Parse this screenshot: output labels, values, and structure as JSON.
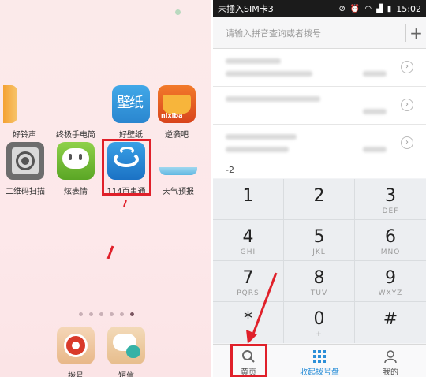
{
  "home": {
    "apps_row1": [
      {
        "label": "好铃声",
        "icon": "ringtone-icon"
      },
      {
        "label": "终极手电筒",
        "icon": "flashlight-icon"
      },
      {
        "label": "好壁纸",
        "icon": "wallpaper-icon"
      },
      {
        "label": "逆袭吧",
        "icon": "nixiba-icon"
      }
    ],
    "nixiba_text": "nixiba",
    "wallpaper_glyph": "壁纸",
    "apps_row2": [
      {
        "label": "二维码扫描",
        "icon": "qrcode-scanner-icon"
      },
      {
        "label": "炫表情",
        "icon": "emoji-chat-icon"
      },
      {
        "label": "114百事通",
        "icon": "baishitong-icon"
      },
      {
        "label": "天气预报",
        "icon": "weather-icon"
      }
    ],
    "dock": [
      {
        "label": "拨号",
        "icon": "phone-dial-icon"
      },
      {
        "label": "短信",
        "icon": "sms-icon"
      }
    ],
    "colors": {
      "highlight": "#e0202a"
    }
  },
  "status_bar": {
    "carrier": "未插入SIM卡3",
    "time": "15:02"
  },
  "search": {
    "placeholder": "请输入拼音查询或者拨号",
    "add": "+"
  },
  "dial_prefix": "-2",
  "keypad": [
    {
      "digit": "1",
      "letters": ""
    },
    {
      "digit": "2",
      "letters": ""
    },
    {
      "digit": "3",
      "letters": "DEF"
    },
    {
      "digit": "4",
      "letters": "GHI"
    },
    {
      "digit": "5",
      "letters": "JKL"
    },
    {
      "digit": "6",
      "letters": "MNO"
    },
    {
      "digit": "7",
      "letters": "PQRS"
    },
    {
      "digit": "8",
      "letters": "TUV"
    },
    {
      "digit": "9",
      "letters": "WXYZ"
    },
    {
      "digit": "*",
      "letters": ""
    },
    {
      "digit": "0",
      "letters": "+"
    },
    {
      "digit": "#",
      "letters": ""
    }
  ],
  "tabs": {
    "yellow_pages": "黄页",
    "collapse_dialpad": "收起拨号盘",
    "mine": "我的"
  },
  "accent_color": "#2b8fd8"
}
